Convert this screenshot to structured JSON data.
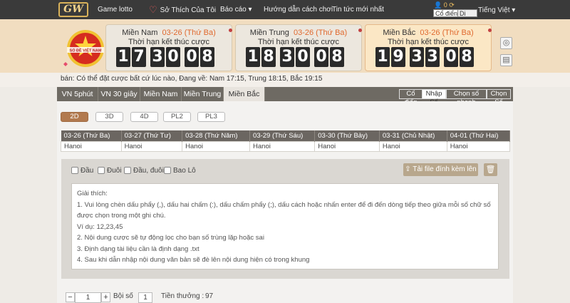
{
  "nav": {
    "logo": "GW",
    "items": [
      "Game lotto",
      "Sở Thích Của Tôi",
      "Báo cáo",
      "Hướng dẫn cách chơi",
      "Tin tức mới nhất"
    ],
    "user_count": "0",
    "mode_classic": "Cổ điển",
    "mode_mobile": "Di động",
    "language": "Tiếng Việt"
  },
  "emblem_text": "SỔ ĐỀ VIỆT NAM",
  "timers": [
    {
      "region": "Miền Nam",
      "date": "03-26 (Thứ Ba)",
      "caption": "Thời hạn kết thúc cược",
      "digits": [
        "1",
        "7",
        "3",
        "0",
        "0",
        "8"
      ]
    },
    {
      "region": "Miền Trung",
      "date": "03-26 (Thứ Ba)",
      "caption": "Thời hạn kết thúc cược",
      "digits": [
        "1",
        "8",
        "3",
        "0",
        "0",
        "8"
      ]
    },
    {
      "region": "Miền Bắc",
      "date": "03-26 (Thứ Ba)",
      "caption": "Thời hạn kết thúc cược",
      "digits": [
        "1",
        "9",
        "3",
        "3",
        "0",
        "8"
      ]
    }
  ],
  "notice": "bán: Có thể đặt cược bất cứ lúc nào,  Đang về: Nam 17:15, Trung 18:15, Bắc 19:15",
  "tabs": [
    "VN 5phút",
    "VN 30 giây",
    "Miền Nam",
    "Miền Trung",
    "Miền Bắc"
  ],
  "right_tabs": [
    "Cổ điển",
    "Nhập Số",
    "Chọn số nhanh",
    "Chọn Số"
  ],
  "pills": [
    "2D",
    "3D",
    "4D",
    "PL2",
    "PL3"
  ],
  "dates": [
    "03-26 (Thứ Ba)",
    "03-27 (Thứ Tư)",
    "03-28 (Thứ Năm)",
    "03-29 (Thứ Sáu)",
    "03-30 (Thứ Bảy)",
    "03-31 (Chủ Nhật)",
    "04-01 (Thứ Hai)"
  ],
  "cities": [
    "Hanoi",
    "Hanoi",
    "Hanoi",
    "Hanoi",
    "Hanoi",
    "Hanoi",
    "Hanoi"
  ],
  "checkboxes": [
    "Đầu",
    "Đuôi",
    "Đầu, đuôi",
    "Bao Lô"
  ],
  "upload_label": "Tải file đính kèm lên",
  "help": {
    "title": "Giải thích:",
    "lines": [
      "1. Vui lòng chèn dấu phẩy (,), dấu hai chấm (:), dấu chấm phẩy (;), dấu cách hoặc nhấn enter để đi đến dòng tiếp theo giữa mỗi số chữ số được chọn trong một ghi chú.",
      "Ví dụ: 12,23,45",
      "2. Nội dung cược sẽ tự động lọc cho bạn số trùng lặp hoặc sai",
      "3. Định dạng tài liệu cần là định dạng .txt",
      "4. Sau khi dẫn nhập nội dung văn bản sẽ đè lên nội dung hiện có trong khung"
    ]
  },
  "bottom": {
    "minus": "−",
    "qty": "1",
    "plus": "+",
    "multiplier_label": "Bội số",
    "multiplier": "1",
    "prize_label": "Tiền thưởng :",
    "prize": "97"
  }
}
